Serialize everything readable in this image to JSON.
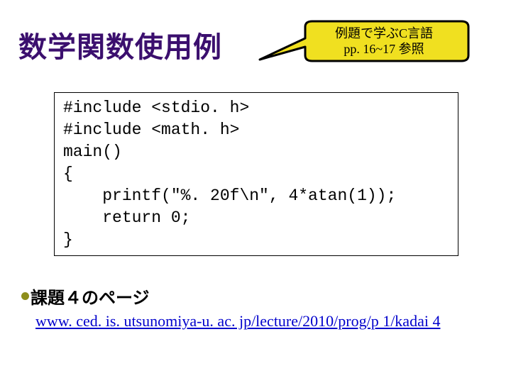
{
  "title": "数学関数使用例",
  "callout": {
    "line1": "例題で学ぶC言語",
    "line2": "pp. 16~17 参照"
  },
  "code": "#include <stdio. h>\n#include <math. h>\nmain()\n{\n    printf(\"%. 20f\\n\", 4*atan(1));\n    return 0;\n}",
  "section": "課題４のページ",
  "link_text": "www. ced. is. utsunomiya-u. ac. jp/lecture/2010/prog/p 1/kadai 4"
}
